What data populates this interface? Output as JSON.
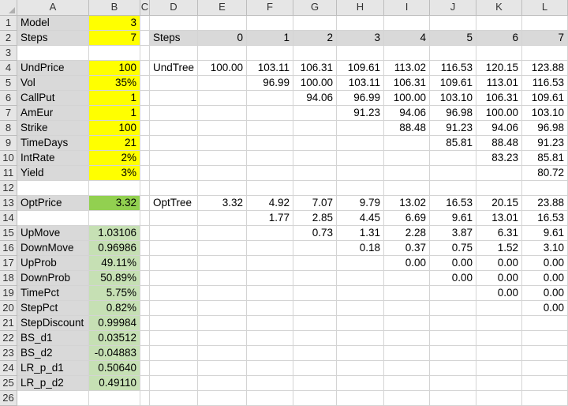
{
  "columns": [
    "A",
    "B",
    "C",
    "D",
    "E",
    "F",
    "G",
    "H",
    "I",
    "J",
    "K",
    "L"
  ],
  "rows": [
    "1",
    "2",
    "3",
    "4",
    "5",
    "6",
    "7",
    "8",
    "9",
    "10",
    "11",
    "12",
    "13",
    "14",
    "15",
    "16",
    "17",
    "18",
    "19",
    "20",
    "21",
    "22",
    "23",
    "24",
    "25",
    "26"
  ],
  "colors": {
    "input_yellow": "#ffff00",
    "result_green": "#92d050",
    "calc_green": "#c6e0b4",
    "label_gray": "#d9d9d9"
  },
  "cells": {
    "A1": "Model",
    "B1": "3",
    "A2": "Steps",
    "B2": "7",
    "D2": "Steps",
    "E2": "0",
    "F2": "1",
    "G2": "2",
    "H2": "3",
    "I2": "4",
    "J2": "5",
    "K2": "6",
    "L2": "7",
    "A4": "UndPrice",
    "B4": "100",
    "D4": "UndTree",
    "E4": "100.00",
    "F4": "103.11",
    "G4": "106.31",
    "H4": "109.61",
    "I4": "113.02",
    "J4": "116.53",
    "K4": "120.15",
    "L4": "123.88",
    "A5": "Vol",
    "B5": "35%",
    "F5": "96.99",
    "G5": "100.00",
    "H5": "103.11",
    "I5": "106.31",
    "J5": "109.61",
    "K5": "113.01",
    "L5": "116.53",
    "A6": "CallPut",
    "B6": "1",
    "G6": "94.06",
    "H6": "96.99",
    "I6": "100.00",
    "J6": "103.10",
    "K6": "106.31",
    "L6": "109.61",
    "A7": "AmEur",
    "B7": "1",
    "H7": "91.23",
    "I7": "94.06",
    "J7": "96.98",
    "K7": "100.00",
    "L7": "103.10",
    "A8": "Strike",
    "B8": "100",
    "I8": "88.48",
    "J8": "91.23",
    "K8": "94.06",
    "L8": "96.98",
    "A9": "TimeDays",
    "B9": "21",
    "J9": "85.81",
    "K9": "88.48",
    "L9": "91.23",
    "A10": "IntRate",
    "B10": "2%",
    "K10": "83.23",
    "L10": "85.81",
    "A11": "Yield",
    "B11": "3%",
    "L11": "80.72",
    "A13": "OptPrice",
    "B13": "3.32",
    "D13": "OptTree",
    "E13": "3.32",
    "F13": "4.92",
    "G13": "7.07",
    "H13": "9.79",
    "I13": "13.02",
    "J13": "16.53",
    "K13": "20.15",
    "L13": "23.88",
    "F14": "1.77",
    "G14": "2.85",
    "H14": "4.45",
    "I14": "6.69",
    "J14": "9.61",
    "K14": "13.01",
    "L14": "16.53",
    "A15": "UpMove",
    "B15": "1.03106",
    "G15": "0.73",
    "H15": "1.31",
    "I15": "2.28",
    "J15": "3.87",
    "K15": "6.31",
    "L15": "9.61",
    "A16": "DownMove",
    "B16": "0.96986",
    "H16": "0.18",
    "I16": "0.37",
    "J16": "0.75",
    "K16": "1.52",
    "L16": "3.10",
    "A17": "UpProb",
    "B17": "49.11%",
    "I17": "0.00",
    "J17": "0.00",
    "K17": "0.00",
    "L17": "0.00",
    "A18": "DownProb",
    "B18": "50.89%",
    "J18": "0.00",
    "K18": "0.00",
    "L18": "0.00",
    "A19": "TimePct",
    "B19": "5.75%",
    "K19": "0.00",
    "L19": "0.00",
    "A20": "StepPct",
    "B20": "0.82%",
    "L20": "0.00",
    "A21": "StepDiscount",
    "B21": "0.99984",
    "A22": "BS_d1",
    "B22": "0.03512",
    "A23": "BS_d2",
    "B23": "-0.04883",
    "A24": "LR_p_d1",
    "B24": "0.50640",
    "A25": "LR_p_d2",
    "B25": "0.49110"
  }
}
